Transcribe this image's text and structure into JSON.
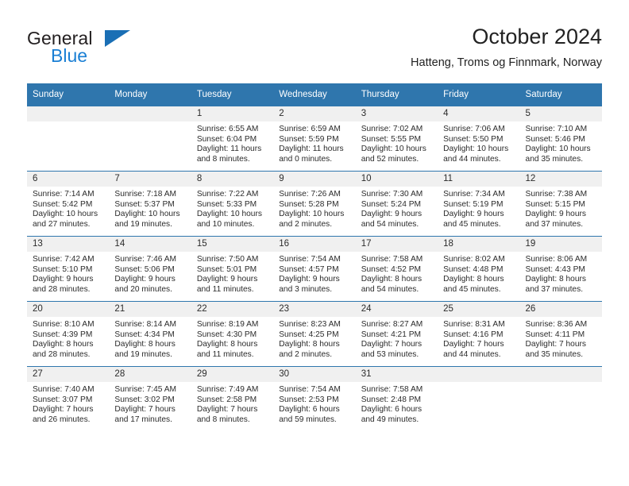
{
  "brand": {
    "name_top": "General",
    "name_bottom": "Blue",
    "accent_color": "#1a7fd4",
    "triangle_color": "#1a6fb5"
  },
  "header": {
    "title": "October 2024",
    "subtitle": "Hatteng, Troms og Finnmark, Norway"
  },
  "calendar": {
    "header_color": "#2f76ad",
    "daynum_band_color": "#f0f0f0",
    "weekday_labels": [
      "Sunday",
      "Monday",
      "Tuesday",
      "Wednesday",
      "Thursday",
      "Friday",
      "Saturday"
    ],
    "weeks": [
      [
        {
          "day": "",
          "lines": []
        },
        {
          "day": "",
          "lines": []
        },
        {
          "day": "1",
          "lines": [
            "Sunrise: 6:55 AM",
            "Sunset: 6:04 PM",
            "Daylight: 11 hours",
            "and 8 minutes."
          ]
        },
        {
          "day": "2",
          "lines": [
            "Sunrise: 6:59 AM",
            "Sunset: 5:59 PM",
            "Daylight: 11 hours",
            "and 0 minutes."
          ]
        },
        {
          "day": "3",
          "lines": [
            "Sunrise: 7:02 AM",
            "Sunset: 5:55 PM",
            "Daylight: 10 hours",
            "and 52 minutes."
          ]
        },
        {
          "day": "4",
          "lines": [
            "Sunrise: 7:06 AM",
            "Sunset: 5:50 PM",
            "Daylight: 10 hours",
            "and 44 minutes."
          ]
        },
        {
          "day": "5",
          "lines": [
            "Sunrise: 7:10 AM",
            "Sunset: 5:46 PM",
            "Daylight: 10 hours",
            "and 35 minutes."
          ]
        }
      ],
      [
        {
          "day": "6",
          "lines": [
            "Sunrise: 7:14 AM",
            "Sunset: 5:42 PM",
            "Daylight: 10 hours",
            "and 27 minutes."
          ]
        },
        {
          "day": "7",
          "lines": [
            "Sunrise: 7:18 AM",
            "Sunset: 5:37 PM",
            "Daylight: 10 hours",
            "and 19 minutes."
          ]
        },
        {
          "day": "8",
          "lines": [
            "Sunrise: 7:22 AM",
            "Sunset: 5:33 PM",
            "Daylight: 10 hours",
            "and 10 minutes."
          ]
        },
        {
          "day": "9",
          "lines": [
            "Sunrise: 7:26 AM",
            "Sunset: 5:28 PM",
            "Daylight: 10 hours",
            "and 2 minutes."
          ]
        },
        {
          "day": "10",
          "lines": [
            "Sunrise: 7:30 AM",
            "Sunset: 5:24 PM",
            "Daylight: 9 hours",
            "and 54 minutes."
          ]
        },
        {
          "day": "11",
          "lines": [
            "Sunrise: 7:34 AM",
            "Sunset: 5:19 PM",
            "Daylight: 9 hours",
            "and 45 minutes."
          ]
        },
        {
          "day": "12",
          "lines": [
            "Sunrise: 7:38 AM",
            "Sunset: 5:15 PM",
            "Daylight: 9 hours",
            "and 37 minutes."
          ]
        }
      ],
      [
        {
          "day": "13",
          "lines": [
            "Sunrise: 7:42 AM",
            "Sunset: 5:10 PM",
            "Daylight: 9 hours",
            "and 28 minutes."
          ]
        },
        {
          "day": "14",
          "lines": [
            "Sunrise: 7:46 AM",
            "Sunset: 5:06 PM",
            "Daylight: 9 hours",
            "and 20 minutes."
          ]
        },
        {
          "day": "15",
          "lines": [
            "Sunrise: 7:50 AM",
            "Sunset: 5:01 PM",
            "Daylight: 9 hours",
            "and 11 minutes."
          ]
        },
        {
          "day": "16",
          "lines": [
            "Sunrise: 7:54 AM",
            "Sunset: 4:57 PM",
            "Daylight: 9 hours",
            "and 3 minutes."
          ]
        },
        {
          "day": "17",
          "lines": [
            "Sunrise: 7:58 AM",
            "Sunset: 4:52 PM",
            "Daylight: 8 hours",
            "and 54 minutes."
          ]
        },
        {
          "day": "18",
          "lines": [
            "Sunrise: 8:02 AM",
            "Sunset: 4:48 PM",
            "Daylight: 8 hours",
            "and 45 minutes."
          ]
        },
        {
          "day": "19",
          "lines": [
            "Sunrise: 8:06 AM",
            "Sunset: 4:43 PM",
            "Daylight: 8 hours",
            "and 37 minutes."
          ]
        }
      ],
      [
        {
          "day": "20",
          "lines": [
            "Sunrise: 8:10 AM",
            "Sunset: 4:39 PM",
            "Daylight: 8 hours",
            "and 28 minutes."
          ]
        },
        {
          "day": "21",
          "lines": [
            "Sunrise: 8:14 AM",
            "Sunset: 4:34 PM",
            "Daylight: 8 hours",
            "and 19 minutes."
          ]
        },
        {
          "day": "22",
          "lines": [
            "Sunrise: 8:19 AM",
            "Sunset: 4:30 PM",
            "Daylight: 8 hours",
            "and 11 minutes."
          ]
        },
        {
          "day": "23",
          "lines": [
            "Sunrise: 8:23 AM",
            "Sunset: 4:25 PM",
            "Daylight: 8 hours",
            "and 2 minutes."
          ]
        },
        {
          "day": "24",
          "lines": [
            "Sunrise: 8:27 AM",
            "Sunset: 4:21 PM",
            "Daylight: 7 hours",
            "and 53 minutes."
          ]
        },
        {
          "day": "25",
          "lines": [
            "Sunrise: 8:31 AM",
            "Sunset: 4:16 PM",
            "Daylight: 7 hours",
            "and 44 minutes."
          ]
        },
        {
          "day": "26",
          "lines": [
            "Sunrise: 8:36 AM",
            "Sunset: 4:11 PM",
            "Daylight: 7 hours",
            "and 35 minutes."
          ]
        }
      ],
      [
        {
          "day": "27",
          "lines": [
            "Sunrise: 7:40 AM",
            "Sunset: 3:07 PM",
            "Daylight: 7 hours",
            "and 26 minutes."
          ]
        },
        {
          "day": "28",
          "lines": [
            "Sunrise: 7:45 AM",
            "Sunset: 3:02 PM",
            "Daylight: 7 hours",
            "and 17 minutes."
          ]
        },
        {
          "day": "29",
          "lines": [
            "Sunrise: 7:49 AM",
            "Sunset: 2:58 PM",
            "Daylight: 7 hours",
            "and 8 minutes."
          ]
        },
        {
          "day": "30",
          "lines": [
            "Sunrise: 7:54 AM",
            "Sunset: 2:53 PM",
            "Daylight: 6 hours",
            "and 59 minutes."
          ]
        },
        {
          "day": "31",
          "lines": [
            "Sunrise: 7:58 AM",
            "Sunset: 2:48 PM",
            "Daylight: 6 hours",
            "and 49 minutes."
          ]
        },
        {
          "day": "",
          "lines": []
        },
        {
          "day": "",
          "lines": []
        }
      ]
    ]
  }
}
